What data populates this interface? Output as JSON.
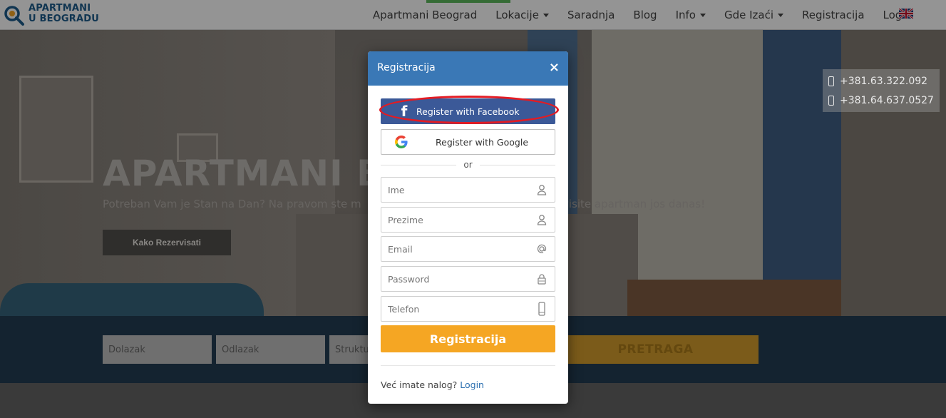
{
  "logo": {
    "line1": "APARTMANI",
    "line2": "U BEOGRADU"
  },
  "nav": {
    "items": [
      {
        "label": "Apartmani Beograd",
        "dropdown": false
      },
      {
        "label": "Lokacije",
        "dropdown": true
      },
      {
        "label": "Saradnja",
        "dropdown": false
      },
      {
        "label": "Blog",
        "dropdown": false
      },
      {
        "label": "Info",
        "dropdown": true
      },
      {
        "label": "Gde Izaći",
        "dropdown": true
      },
      {
        "label": "Registracija",
        "dropdown": false
      },
      {
        "label": "Login",
        "dropdown": false
      }
    ],
    "language_icon": "uk-flag-icon"
  },
  "hero": {
    "title": "APARTMANI B",
    "subtitle": "Potreban Vam je Stan na Dan? Na pravom ste m                                                        ervisite apartman jos danas!",
    "button": "Kako Rezervisati"
  },
  "phones": [
    "+381.63.322.092",
    "+381.64.637.0527"
  ],
  "search": {
    "arrival_placeholder": "Dolazak",
    "departure_placeholder": "Odlazak",
    "structure_placeholder": "Struktu",
    "button": "PRETRAGA"
  },
  "modal": {
    "title": "Registracija",
    "close": "×",
    "facebook_button": "Register with Facebook",
    "google_button": "Register with Google",
    "or": "or",
    "fields": [
      {
        "placeholder": "Ime",
        "icon": "user-icon"
      },
      {
        "placeholder": "Prezime",
        "icon": "user-icon"
      },
      {
        "placeholder": "Email",
        "icon": "at-icon"
      },
      {
        "placeholder": "Password",
        "icon": "lock-icon"
      },
      {
        "placeholder": "Telefon",
        "icon": "mobile-icon"
      }
    ],
    "submit": "Registracija",
    "footer_text": "Već imate nalog?",
    "footer_link": "Login"
  },
  "colors": {
    "modal_header": "#3a78b6",
    "facebook": "#3b5998",
    "submit": "#f5a623",
    "highlight": "#e31b23",
    "link": "#2a6fb0"
  }
}
